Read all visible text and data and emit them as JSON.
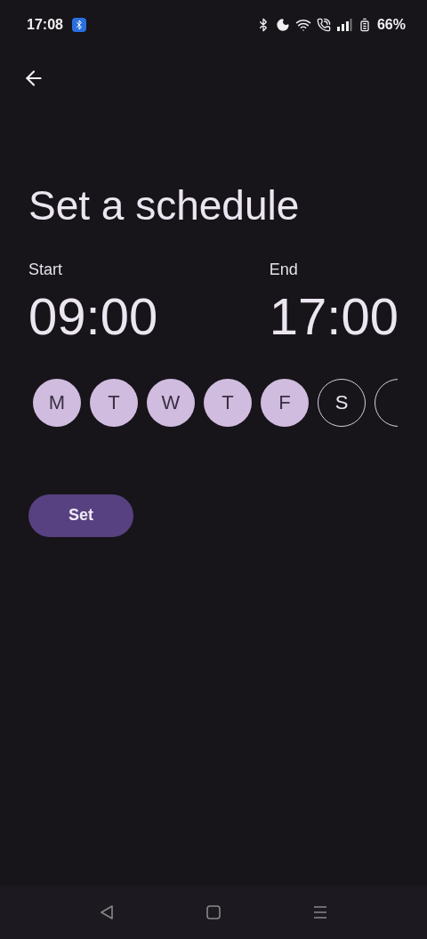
{
  "status_bar": {
    "time": "17:08",
    "battery": "66%"
  },
  "title": "Set a schedule",
  "start": {
    "label": "Start",
    "time": "09:00"
  },
  "end": {
    "label": "End",
    "time": "17:00"
  },
  "days": [
    {
      "label": "M",
      "selected": true
    },
    {
      "label": "T",
      "selected": true
    },
    {
      "label": "W",
      "selected": true
    },
    {
      "label": "T",
      "selected": true
    },
    {
      "label": "F",
      "selected": true
    },
    {
      "label": "S",
      "selected": false
    },
    {
      "selected": false
    }
  ],
  "button": "Set"
}
